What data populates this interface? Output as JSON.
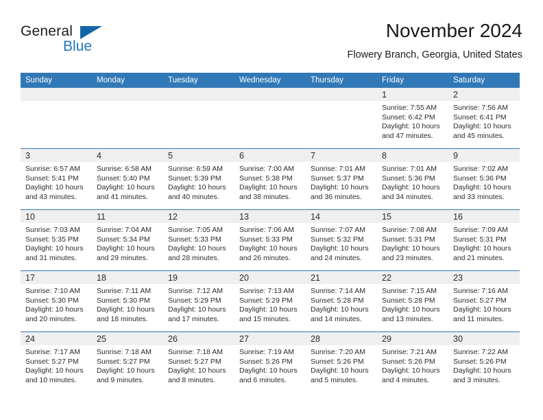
{
  "brand": {
    "name_top": "General",
    "name_bottom": "Blue",
    "accent_color": "#1f77bd",
    "triangle_color": "#1566a8"
  },
  "header": {
    "title": "November 2024",
    "subtitle": "Flowery Branch, Georgia, United States"
  },
  "theme": {
    "header_bg": "#3178b6",
    "header_text": "#ffffff",
    "daynum_bg": "#efefef",
    "cell_bg": "#ffffff",
    "row_rule": "#3178b6"
  },
  "weekdays": [
    "Sunday",
    "Monday",
    "Tuesday",
    "Wednesday",
    "Thursday",
    "Friday",
    "Saturday"
  ],
  "weeks": [
    [
      {
        "day": "",
        "sunrise": "",
        "sunset": "",
        "daylight": "",
        "daylight2": "",
        "empty": true
      },
      {
        "day": "",
        "sunrise": "",
        "sunset": "",
        "daylight": "",
        "daylight2": "",
        "empty": true
      },
      {
        "day": "",
        "sunrise": "",
        "sunset": "",
        "daylight": "",
        "daylight2": "",
        "empty": true
      },
      {
        "day": "",
        "sunrise": "",
        "sunset": "",
        "daylight": "",
        "daylight2": "",
        "empty": true
      },
      {
        "day": "",
        "sunrise": "",
        "sunset": "",
        "daylight": "",
        "daylight2": "",
        "empty": true
      },
      {
        "day": "1",
        "sunrise": "Sunrise: 7:55 AM",
        "sunset": "Sunset: 6:42 PM",
        "daylight": "Daylight: 10 hours",
        "daylight2": "and 47 minutes.",
        "empty": false
      },
      {
        "day": "2",
        "sunrise": "Sunrise: 7:56 AM",
        "sunset": "Sunset: 6:41 PM",
        "daylight": "Daylight: 10 hours",
        "daylight2": "and 45 minutes.",
        "empty": false
      }
    ],
    [
      {
        "day": "3",
        "sunrise": "Sunrise: 6:57 AM",
        "sunset": "Sunset: 5:41 PM",
        "daylight": "Daylight: 10 hours",
        "daylight2": "and 43 minutes.",
        "empty": false
      },
      {
        "day": "4",
        "sunrise": "Sunrise: 6:58 AM",
        "sunset": "Sunset: 5:40 PM",
        "daylight": "Daylight: 10 hours",
        "daylight2": "and 41 minutes.",
        "empty": false
      },
      {
        "day": "5",
        "sunrise": "Sunrise: 6:59 AM",
        "sunset": "Sunset: 5:39 PM",
        "daylight": "Daylight: 10 hours",
        "daylight2": "and 40 minutes.",
        "empty": false
      },
      {
        "day": "6",
        "sunrise": "Sunrise: 7:00 AM",
        "sunset": "Sunset: 5:38 PM",
        "daylight": "Daylight: 10 hours",
        "daylight2": "and 38 minutes.",
        "empty": false
      },
      {
        "day": "7",
        "sunrise": "Sunrise: 7:01 AM",
        "sunset": "Sunset: 5:37 PM",
        "daylight": "Daylight: 10 hours",
        "daylight2": "and 36 minutes.",
        "empty": false
      },
      {
        "day": "8",
        "sunrise": "Sunrise: 7:01 AM",
        "sunset": "Sunset: 5:36 PM",
        "daylight": "Daylight: 10 hours",
        "daylight2": "and 34 minutes.",
        "empty": false
      },
      {
        "day": "9",
        "sunrise": "Sunrise: 7:02 AM",
        "sunset": "Sunset: 5:36 PM",
        "daylight": "Daylight: 10 hours",
        "daylight2": "and 33 minutes.",
        "empty": false
      }
    ],
    [
      {
        "day": "10",
        "sunrise": "Sunrise: 7:03 AM",
        "sunset": "Sunset: 5:35 PM",
        "daylight": "Daylight: 10 hours",
        "daylight2": "and 31 minutes.",
        "empty": false
      },
      {
        "day": "11",
        "sunrise": "Sunrise: 7:04 AM",
        "sunset": "Sunset: 5:34 PM",
        "daylight": "Daylight: 10 hours",
        "daylight2": "and 29 minutes.",
        "empty": false
      },
      {
        "day": "12",
        "sunrise": "Sunrise: 7:05 AM",
        "sunset": "Sunset: 5:33 PM",
        "daylight": "Daylight: 10 hours",
        "daylight2": "and 28 minutes.",
        "empty": false
      },
      {
        "day": "13",
        "sunrise": "Sunrise: 7:06 AM",
        "sunset": "Sunset: 5:33 PM",
        "daylight": "Daylight: 10 hours",
        "daylight2": "and 26 minutes.",
        "empty": false
      },
      {
        "day": "14",
        "sunrise": "Sunrise: 7:07 AM",
        "sunset": "Sunset: 5:32 PM",
        "daylight": "Daylight: 10 hours",
        "daylight2": "and 24 minutes.",
        "empty": false
      },
      {
        "day": "15",
        "sunrise": "Sunrise: 7:08 AM",
        "sunset": "Sunset: 5:31 PM",
        "daylight": "Daylight: 10 hours",
        "daylight2": "and 23 minutes.",
        "empty": false
      },
      {
        "day": "16",
        "sunrise": "Sunrise: 7:09 AM",
        "sunset": "Sunset: 5:31 PM",
        "daylight": "Daylight: 10 hours",
        "daylight2": "and 21 minutes.",
        "empty": false
      }
    ],
    [
      {
        "day": "17",
        "sunrise": "Sunrise: 7:10 AM",
        "sunset": "Sunset: 5:30 PM",
        "daylight": "Daylight: 10 hours",
        "daylight2": "and 20 minutes.",
        "empty": false
      },
      {
        "day": "18",
        "sunrise": "Sunrise: 7:11 AM",
        "sunset": "Sunset: 5:30 PM",
        "daylight": "Daylight: 10 hours",
        "daylight2": "and 18 minutes.",
        "empty": false
      },
      {
        "day": "19",
        "sunrise": "Sunrise: 7:12 AM",
        "sunset": "Sunset: 5:29 PM",
        "daylight": "Daylight: 10 hours",
        "daylight2": "and 17 minutes.",
        "empty": false
      },
      {
        "day": "20",
        "sunrise": "Sunrise: 7:13 AM",
        "sunset": "Sunset: 5:29 PM",
        "daylight": "Daylight: 10 hours",
        "daylight2": "and 15 minutes.",
        "empty": false
      },
      {
        "day": "21",
        "sunrise": "Sunrise: 7:14 AM",
        "sunset": "Sunset: 5:28 PM",
        "daylight": "Daylight: 10 hours",
        "daylight2": "and 14 minutes.",
        "empty": false
      },
      {
        "day": "22",
        "sunrise": "Sunrise: 7:15 AM",
        "sunset": "Sunset: 5:28 PM",
        "daylight": "Daylight: 10 hours",
        "daylight2": "and 13 minutes.",
        "empty": false
      },
      {
        "day": "23",
        "sunrise": "Sunrise: 7:16 AM",
        "sunset": "Sunset: 5:27 PM",
        "daylight": "Daylight: 10 hours",
        "daylight2": "and 11 minutes.",
        "empty": false
      }
    ],
    [
      {
        "day": "24",
        "sunrise": "Sunrise: 7:17 AM",
        "sunset": "Sunset: 5:27 PM",
        "daylight": "Daylight: 10 hours",
        "daylight2": "and 10 minutes.",
        "empty": false
      },
      {
        "day": "25",
        "sunrise": "Sunrise: 7:18 AM",
        "sunset": "Sunset: 5:27 PM",
        "daylight": "Daylight: 10 hours",
        "daylight2": "and 9 minutes.",
        "empty": false
      },
      {
        "day": "26",
        "sunrise": "Sunrise: 7:18 AM",
        "sunset": "Sunset: 5:27 PM",
        "daylight": "Daylight: 10 hours",
        "daylight2": "and 8 minutes.",
        "empty": false
      },
      {
        "day": "27",
        "sunrise": "Sunrise: 7:19 AM",
        "sunset": "Sunset: 5:26 PM",
        "daylight": "Daylight: 10 hours",
        "daylight2": "and 6 minutes.",
        "empty": false
      },
      {
        "day": "28",
        "sunrise": "Sunrise: 7:20 AM",
        "sunset": "Sunset: 5:26 PM",
        "daylight": "Daylight: 10 hours",
        "daylight2": "and 5 minutes.",
        "empty": false
      },
      {
        "day": "29",
        "sunrise": "Sunrise: 7:21 AM",
        "sunset": "Sunset: 5:26 PM",
        "daylight": "Daylight: 10 hours",
        "daylight2": "and 4 minutes.",
        "empty": false
      },
      {
        "day": "30",
        "sunrise": "Sunrise: 7:22 AM",
        "sunset": "Sunset: 5:26 PM",
        "daylight": "Daylight: 10 hours",
        "daylight2": "and 3 minutes.",
        "empty": false
      }
    ]
  ]
}
